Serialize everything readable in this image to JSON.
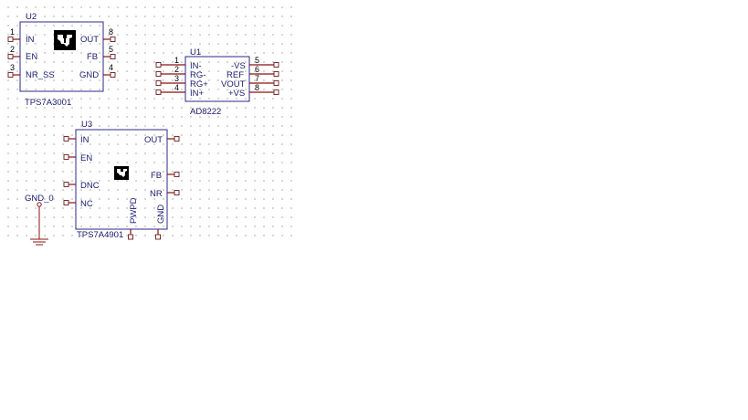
{
  "u2": {
    "refdes": "U2",
    "part": "TPS7A3001",
    "left_pins": [
      {
        "num": "1",
        "name": "IN"
      },
      {
        "num": "2",
        "name": "EN"
      },
      {
        "num": "3",
        "name": "NR_SS"
      }
    ],
    "right_pins": [
      {
        "num": "8",
        "name": "OUT"
      },
      {
        "num": "5",
        "name": "FB"
      },
      {
        "num": "4",
        "name": "GND"
      }
    ]
  },
  "u1": {
    "refdes": "U1",
    "part": "AD8222",
    "left_pins": [
      {
        "num": "1",
        "name": "IN-"
      },
      {
        "num": "2",
        "name": "RG-"
      },
      {
        "num": "3",
        "name": "RG+"
      },
      {
        "num": "4",
        "name": "IN+"
      }
    ],
    "right_pins": [
      {
        "num": "5",
        "name": "-VS"
      },
      {
        "num": "6",
        "name": "REF"
      },
      {
        "num": "7",
        "name": "VOUT"
      },
      {
        "num": "8",
        "name": "+VS"
      }
    ]
  },
  "u3": {
    "refdes": "U3",
    "part": "TPS7A4901",
    "left_pins": [
      {
        "name": "IN"
      },
      {
        "name": "EN"
      },
      {
        "name": "DNC"
      },
      {
        "name": "NC"
      }
    ],
    "right_pins": [
      {
        "name": "OUT"
      },
      {
        "name": "FB"
      },
      {
        "name": "NR"
      }
    ],
    "bottom_pins": [
      {
        "name": "PWPD"
      },
      {
        "name": "GND"
      }
    ]
  },
  "gnd0": {
    "label": "GND_0"
  },
  "colors": {
    "body": "#2a2a8a",
    "lead": "#8a1010",
    "text": "#1a1a6e"
  }
}
